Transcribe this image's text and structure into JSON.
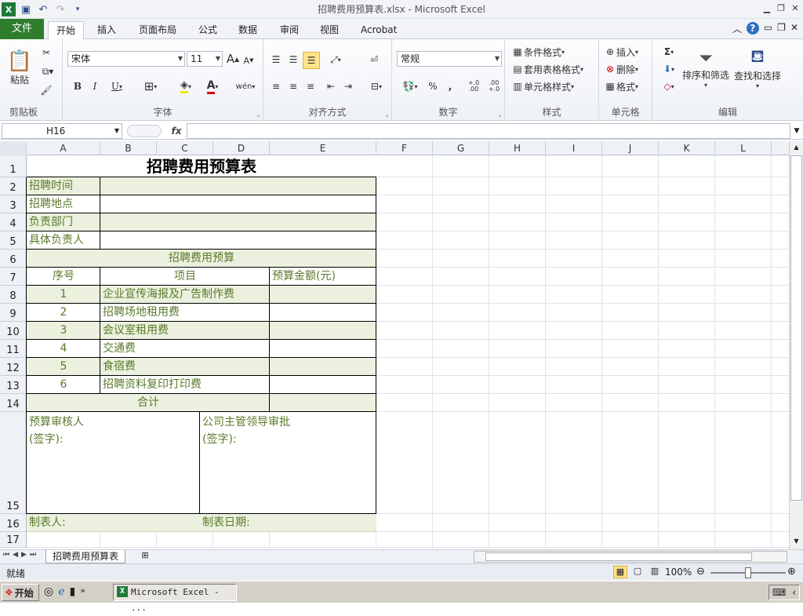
{
  "window": {
    "title": "招聘费用预算表.xlsx  -  Microsoft Excel"
  },
  "tabs": [
    "文件",
    "开始",
    "插入",
    "页面布局",
    "公式",
    "数据",
    "审阅",
    "视图",
    "Acrobat"
  ],
  "ribbon": {
    "groups": {
      "clipboard": "剪贴板",
      "font": "字体",
      "alignment": "对齐方式",
      "number": "数字",
      "styles": "样式",
      "cells": "单元格",
      "editing": "编辑"
    },
    "paste_label": "粘贴",
    "font_name": "宋体",
    "font_size": "11",
    "number_format": "常规",
    "conditional_format": "条件格式",
    "table_format": "套用表格格式",
    "cell_styles": "单元格样式",
    "insert": "插入",
    "delete": "删除",
    "format": "格式",
    "sort_filter": "排序和筛选",
    "find_select": "查找和选择",
    "bold": "B",
    "italic": "I",
    "underline": "U",
    "font_grow": "A",
    "font_shrink": "A",
    "font_color": "A",
    "wen": "wén",
    "percent": "%",
    "comma": ",",
    "inc_dec": "+.0 .00",
    "dec_dec": ".00 +.0",
    "sigma": "Σ"
  },
  "formula_bar": {
    "name_box": "H16",
    "fx": "fx",
    "value": ""
  },
  "columns": [
    "A",
    "B",
    "C",
    "D",
    "E",
    "F",
    "G",
    "H",
    "I",
    "J",
    "K",
    "L"
  ],
  "rows": [
    "1",
    "2",
    "3",
    "4",
    "5",
    "6",
    "7",
    "8",
    "9",
    "10",
    "11",
    "12",
    "13",
    "14",
    "15",
    "16",
    "17"
  ],
  "sheet": {
    "title": "招聘费用预算表",
    "time_label": "招聘时间",
    "place_label": "招聘地点",
    "dept_label": "负责部门",
    "person_label": "具体负责人",
    "section_title": "招聘费用预算",
    "head_no": "序号",
    "head_item": "项目",
    "head_amount": "预算金额(元)",
    "items": [
      {
        "no": "1",
        "name": "企业宣传海报及广告制作费"
      },
      {
        "no": "2",
        "name": "招聘场地租用费"
      },
      {
        "no": "3",
        "name": "会议室租用费"
      },
      {
        "no": "4",
        "name": "交通费"
      },
      {
        "no": "5",
        "name": "食宿费"
      },
      {
        "no": "6",
        "name": "招聘资料复印打印费"
      }
    ],
    "total": "合计",
    "reviewer": "预算审核人",
    "sign1": "(签字):",
    "approver": "公司主管领导审批",
    "sign2": "(签字):",
    "maker": "制表人:",
    "date": "制表日期:"
  },
  "sheet_tab": "招聘费用预算表",
  "status": {
    "ready": "就绪",
    "zoom": "100%"
  },
  "taskbar": {
    "start": "开始",
    "app": "Microsoft Excel - ..."
  },
  "colors": {
    "accent_green": "#2d7d2d",
    "cell_fill": "#ebf1de",
    "text_green": "#5a7a2a"
  }
}
